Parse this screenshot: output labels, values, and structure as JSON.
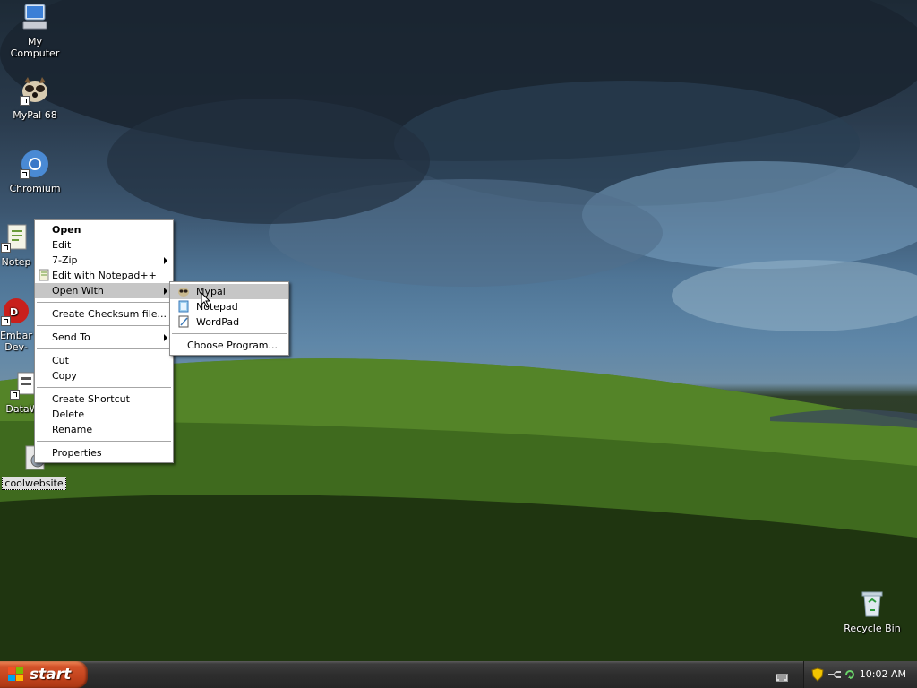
{
  "desktop_icons": [
    {
      "label": "My Computer",
      "icon": "my-computer-icon"
    },
    {
      "label": "MyPal 68",
      "icon": "mypal-icon"
    },
    {
      "label": "Chromium",
      "icon": "chromium-icon"
    },
    {
      "label": "Notep",
      "icon": "notepad-plus-plus-icon"
    },
    {
      "label": "Embar",
      "label2": "Dev-",
      "icon": "embarcadero-devcpp-icon"
    },
    {
      "label": "DataWa",
      "icon": "datawa-icon"
    },
    {
      "label": "coolwebsite",
      "icon": "html-file-icon"
    },
    {
      "label": "Recycle Bin",
      "icon": "recycle-bin-icon"
    }
  ],
  "context_menu": {
    "items": [
      "Open",
      "Edit",
      "7-Zip",
      "Edit with Notepad++",
      "Open With",
      "Create Checksum file...",
      "Send To",
      "Cut",
      "Copy",
      "Create Shortcut",
      "Delete",
      "Rename",
      "Properties"
    ]
  },
  "open_with_menu": {
    "items": [
      "Mypal",
      "Notepad",
      "WordPad",
      "Choose Program..."
    ]
  },
  "taskbar": {
    "start_label": "start",
    "clock": "10:02 AM"
  }
}
